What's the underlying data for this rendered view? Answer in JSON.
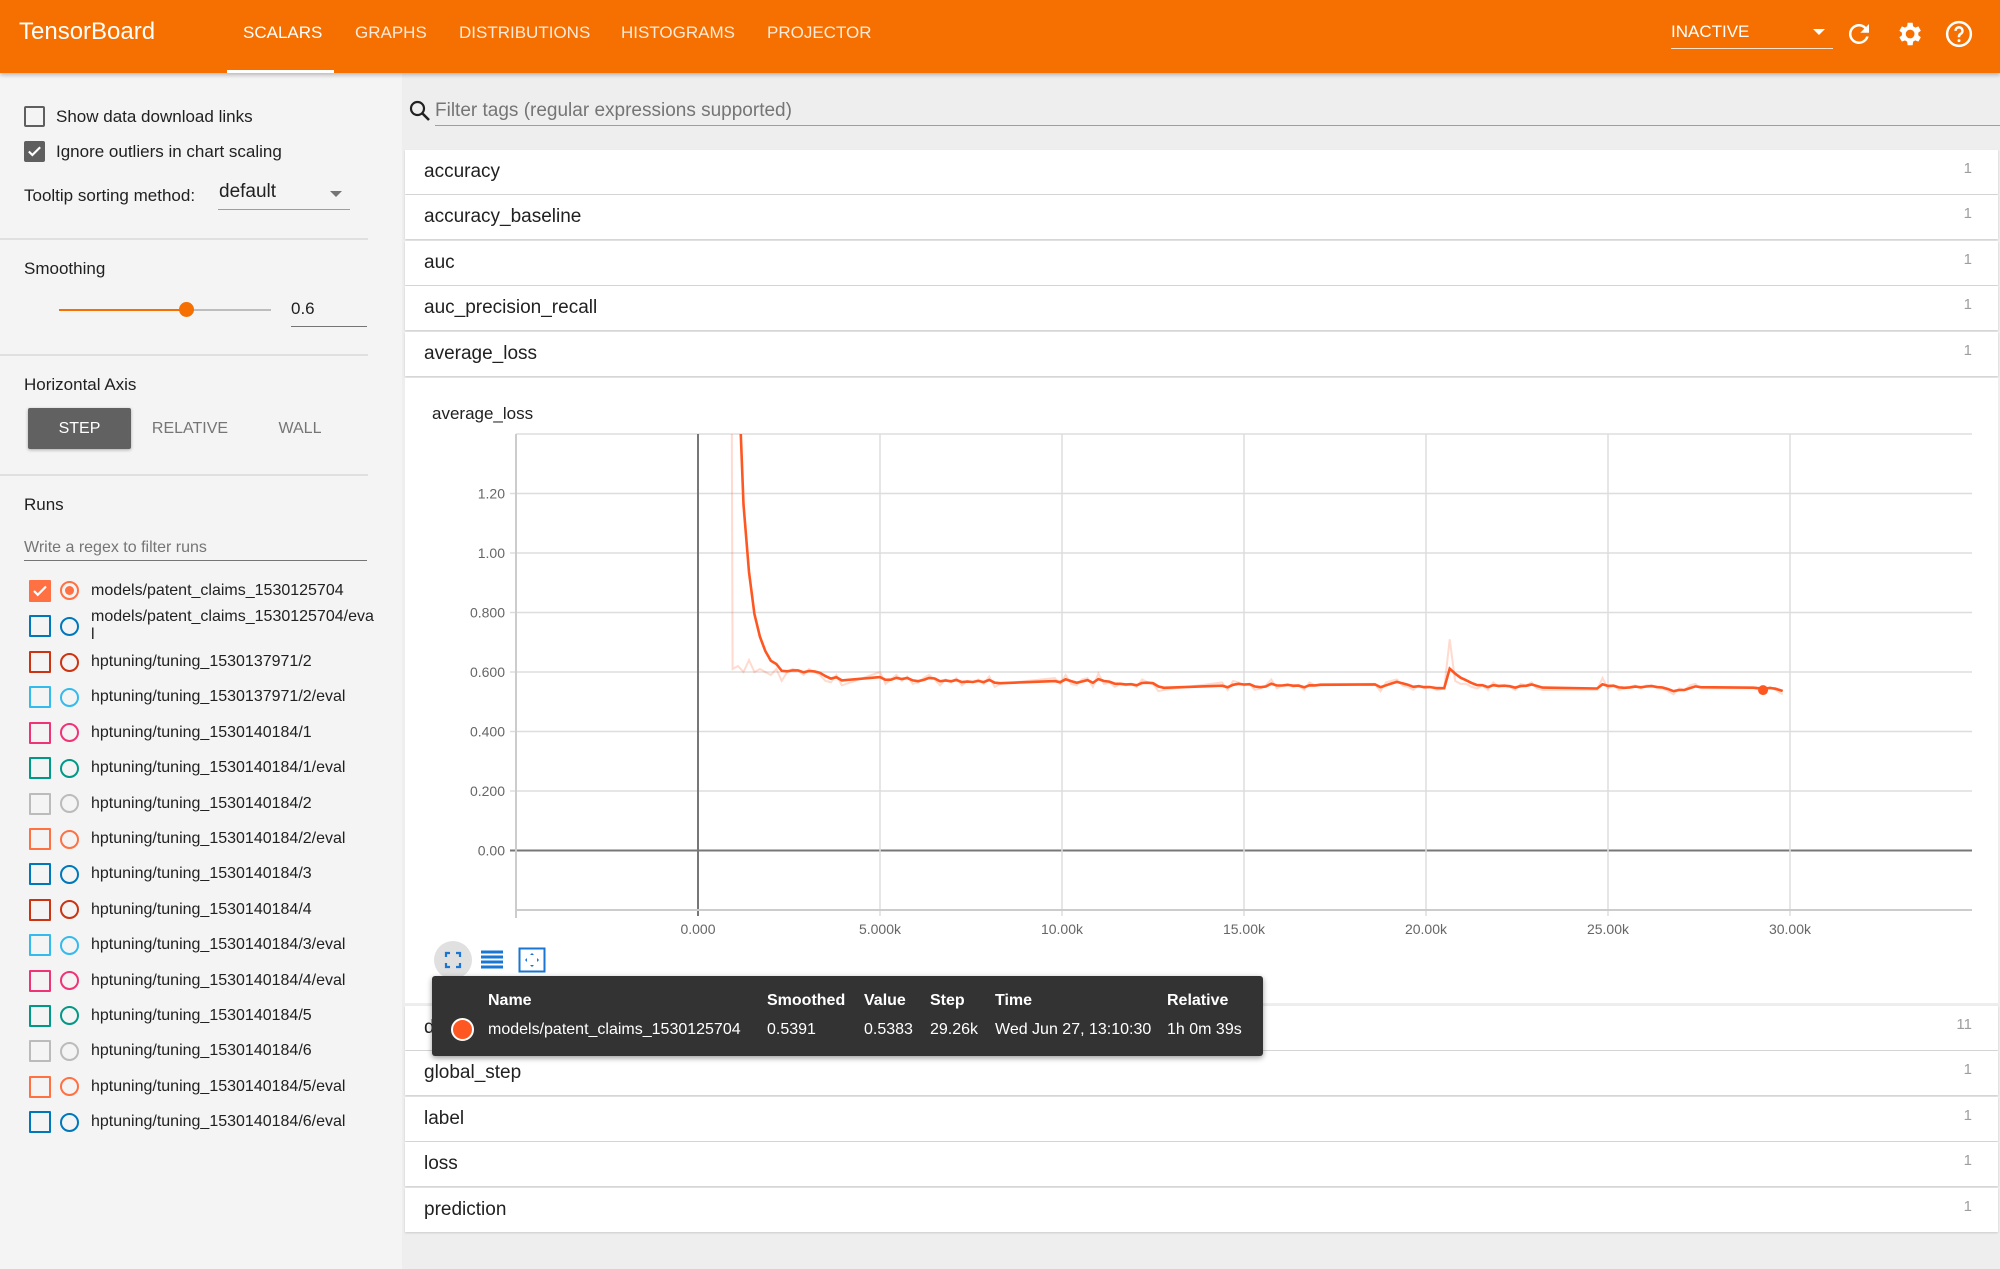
{
  "header": {
    "logo": "TensorBoard",
    "tabs": [
      {
        "label": "SCALARS",
        "active": true
      },
      {
        "label": "GRAPHS",
        "active": false
      },
      {
        "label": "DISTRIBUTIONS",
        "active": false
      },
      {
        "label": "HISTOGRAMS",
        "active": false
      },
      {
        "label": "PROJECTOR",
        "active": false
      }
    ],
    "status_select": "INACTIVE",
    "icons": [
      "refresh-icon",
      "gear-icon",
      "help-icon"
    ],
    "color": "#f57000"
  },
  "sidebar": {
    "show_download_links": {
      "label": "Show data download links",
      "checked": false
    },
    "ignore_outliers": {
      "label": "Ignore outliers in chart scaling",
      "checked": true
    },
    "tooltip_sorting": {
      "label": "Tooltip sorting method:",
      "value": "default"
    },
    "smoothing": {
      "label": "Smoothing",
      "value": "0.6",
      "fraction": 0.6
    },
    "horizontal_axis": {
      "label": "Horizontal Axis",
      "options": [
        "STEP",
        "RELATIVE",
        "WALL"
      ],
      "selected": "STEP"
    },
    "runs": {
      "label": "Runs",
      "filter_placeholder": "Write a regex to filter runs",
      "items": [
        {
          "name": "models/patent_claims_1530125704",
          "color": "#ff7043",
          "checked": true,
          "selected": true
        },
        {
          "name": "models/patent_claims_1530125704/eval",
          "color": "#0077bb",
          "checked": false
        },
        {
          "name": "hptuning/tuning_1530137971/2",
          "color": "#cc3311",
          "checked": false
        },
        {
          "name": "hptuning/tuning_1530137971/2/eval",
          "color": "#33bbee",
          "checked": false
        },
        {
          "name": "hptuning/tuning_1530140184/1",
          "color": "#ee3377",
          "checked": false
        },
        {
          "name": "hptuning/tuning_1530140184/1/eval",
          "color": "#009988",
          "checked": false
        },
        {
          "name": "hptuning/tuning_1530140184/2",
          "color": "#bbbbbb",
          "checked": false
        },
        {
          "name": "hptuning/tuning_1530140184/2/eval",
          "color": "#ff7043",
          "checked": false
        },
        {
          "name": "hptuning/tuning_1530140184/3",
          "color": "#0077bb",
          "checked": false
        },
        {
          "name": "hptuning/tuning_1530140184/4",
          "color": "#cc3311",
          "checked": false
        },
        {
          "name": "hptuning/tuning_1530140184/3/eval",
          "color": "#33bbee",
          "checked": false
        },
        {
          "name": "hptuning/tuning_1530140184/4/eval",
          "color": "#ee3377",
          "checked": false
        },
        {
          "name": "hptuning/tuning_1530140184/5",
          "color": "#009988",
          "checked": false
        },
        {
          "name": "hptuning/tuning_1530140184/6",
          "color": "#bbbbbb",
          "checked": false
        },
        {
          "name": "hptuning/tuning_1530140184/5/eval",
          "color": "#ff7043",
          "checked": false
        },
        {
          "name": "hptuning/tuning_1530140184/6/eval",
          "color": "#0077bb",
          "checked": false
        }
      ]
    }
  },
  "main": {
    "filter_placeholder": "Filter tags (regular expressions supported)",
    "tags_before": [
      {
        "label": "accuracy",
        "count": "1"
      },
      {
        "label": "accuracy_baseline",
        "count": "1"
      },
      {
        "label": "auc",
        "count": "1"
      },
      {
        "label": "auc_precision_recall",
        "count": "1"
      },
      {
        "label": "average_loss",
        "count": "1"
      }
    ],
    "tags_after": [
      {
        "label": "dnn",
        "count": "11"
      },
      {
        "label": "global_step",
        "count": "1"
      },
      {
        "label": "label",
        "count": "1"
      },
      {
        "label": "loss",
        "count": "1"
      },
      {
        "label": "prediction",
        "count": "1"
      }
    ],
    "chart_toolbar": [
      "fullscreen-icon",
      "toggle-log-scale-icon",
      "fit-domain-icon"
    ],
    "tooltip": {
      "headers": [
        "Name",
        "Smoothed",
        "Value",
        "Step",
        "Time",
        "Relative"
      ],
      "row": {
        "name": "models/patent_claims_1530125704",
        "smoothed": "0.5391",
        "value": "0.5383",
        "step": "29.26k",
        "time": "Wed Jun 27, 13:10:30",
        "relative": "1h 0m 39s",
        "color": "#ff5722"
      }
    }
  },
  "chart_data": {
    "type": "line",
    "title": "average_loss",
    "xlabel": "",
    "ylabel": "",
    "xlim": [
      -5000,
      35000
    ],
    "ylim": [
      -0.2,
      1.4
    ],
    "grid": true,
    "x_ticks": [
      0,
      5000,
      10000,
      15000,
      20000,
      25000,
      30000
    ],
    "x_tick_labels": [
      "0.000",
      "5.000k",
      "10.00k",
      "15.00k",
      "20.00k",
      "25.00k",
      "30.00k"
    ],
    "y_ticks": [
      0,
      0.2,
      0.4,
      0.6,
      0.8,
      1.0,
      1.2
    ],
    "y_tick_labels": [
      "0.00",
      "0.200",
      "0.400",
      "0.600",
      "0.800",
      "1.00",
      "1.20"
    ],
    "smoothing": 0.6,
    "color": "#ff5722",
    "highlight": {
      "step": 29260,
      "smoothed": 0.5391,
      "value": 0.5383
    },
    "series": [
      {
        "name": "models/patent_claims_1530125704",
        "points": [
          [
            800,
            6.2
          ],
          [
            950,
            0.61
          ],
          [
            1100,
            0.62
          ],
          [
            1250,
            0.6
          ],
          [
            1400,
            0.64
          ],
          [
            1550,
            0.6
          ],
          [
            1700,
            0.61
          ],
          [
            1850,
            0.6
          ],
          [
            2000,
            0.59
          ],
          [
            2150,
            0.61
          ],
          [
            2300,
            0.57
          ],
          [
            2450,
            0.6
          ],
          [
            2600,
            0.61
          ],
          [
            2750,
            0.605
          ],
          [
            2900,
            0.59
          ],
          [
            3050,
            0.61
          ],
          [
            3200,
            0.6
          ],
          [
            3350,
            0.59
          ],
          [
            3500,
            0.57
          ],
          [
            3650,
            0.565
          ],
          [
            3800,
            0.59
          ],
          [
            3950,
            0.555
          ],
          [
            5000,
            0.6
          ],
          [
            5150,
            0.56
          ],
          [
            5300,
            0.575
          ],
          [
            5450,
            0.59
          ],
          [
            5600,
            0.57
          ],
          [
            5750,
            0.585
          ],
          [
            5900,
            0.56
          ],
          [
            6050,
            0.565
          ],
          [
            6200,
            0.58
          ],
          [
            6350,
            0.59
          ],
          [
            6500,
            0.575
          ],
          [
            6650,
            0.555
          ],
          [
            6800,
            0.575
          ],
          [
            6950,
            0.565
          ],
          [
            7100,
            0.58
          ],
          [
            7250,
            0.555
          ],
          [
            7400,
            0.57
          ],
          [
            7550,
            0.565
          ],
          [
            7700,
            0.575
          ],
          [
            7850,
            0.56
          ],
          [
            8000,
            0.585
          ],
          [
            8150,
            0.55
          ],
          [
            8300,
            0.56
          ],
          [
            9800,
            0.58
          ],
          [
            9950,
            0.56
          ],
          [
            10100,
            0.59
          ],
          [
            10250,
            0.56
          ],
          [
            10400,
            0.555
          ],
          [
            10550,
            0.575
          ],
          [
            10700,
            0.58
          ],
          [
            10850,
            0.55
          ],
          [
            11000,
            0.595
          ],
          [
            11150,
            0.56
          ],
          [
            11300,
            0.565
          ],
          [
            11450,
            0.55
          ],
          [
            11600,
            0.56
          ],
          [
            11750,
            0.555
          ],
          [
            11900,
            0.56
          ],
          [
            12050,
            0.55
          ],
          [
            12200,
            0.575
          ],
          [
            12350,
            0.565
          ],
          [
            12500,
            0.56
          ],
          [
            12650,
            0.535
          ],
          [
            12800,
            0.54
          ],
          [
            14400,
            0.565
          ],
          [
            14550,
            0.54
          ],
          [
            14700,
            0.57
          ],
          [
            14850,
            0.565
          ],
          [
            15000,
            0.555
          ],
          [
            15150,
            0.56
          ],
          [
            15300,
            0.54
          ],
          [
            15450,
            0.545
          ],
          [
            15600,
            0.555
          ],
          [
            15750,
            0.575
          ],
          [
            15900,
            0.545
          ],
          [
            16050,
            0.555
          ],
          [
            16200,
            0.56
          ],
          [
            16350,
            0.55
          ],
          [
            16500,
            0.555
          ],
          [
            16650,
            0.54
          ],
          [
            16800,
            0.565
          ],
          [
            16950,
            0.555
          ],
          [
            17100,
            0.56
          ],
          [
            18600,
            0.56
          ],
          [
            18750,
            0.535
          ],
          [
            18900,
            0.565
          ],
          [
            19050,
            0.57
          ],
          [
            19200,
            0.575
          ],
          [
            19350,
            0.555
          ],
          [
            19500,
            0.55
          ],
          [
            19650,
            0.54
          ],
          [
            19800,
            0.555
          ],
          [
            19950,
            0.545
          ],
          [
            20100,
            0.55
          ],
          [
            20300,
            0.54
          ],
          [
            20500,
            0.545
          ],
          [
            20650,
            0.71
          ],
          [
            20800,
            0.57
          ],
          [
            20950,
            0.56
          ],
          [
            21100,
            0.56
          ],
          [
            21250,
            0.55
          ],
          [
            21400,
            0.545
          ],
          [
            21550,
            0.555
          ],
          [
            21700,
            0.54
          ],
          [
            21850,
            0.565
          ],
          [
            22000,
            0.55
          ],
          [
            22150,
            0.555
          ],
          [
            22300,
            0.55
          ],
          [
            22450,
            0.54
          ],
          [
            22600,
            0.56
          ],
          [
            22750,
            0.555
          ],
          [
            22900,
            0.565
          ],
          [
            23050,
            0.545
          ],
          [
            23200,
            0.54
          ],
          [
            24700,
            0.54
          ],
          [
            24850,
            0.58
          ],
          [
            25000,
            0.545
          ],
          [
            25150,
            0.555
          ],
          [
            25300,
            0.54
          ],
          [
            25450,
            0.545
          ],
          [
            25600,
            0.55
          ],
          [
            25750,
            0.555
          ],
          [
            25900,
            0.545
          ],
          [
            26050,
            0.555
          ],
          [
            26200,
            0.555
          ],
          [
            26350,
            0.545
          ],
          [
            26500,
            0.545
          ],
          [
            26650,
            0.535
          ],
          [
            26800,
            0.525
          ],
          [
            26950,
            0.545
          ],
          [
            27100,
            0.54
          ],
          [
            27250,
            0.555
          ],
          [
            27400,
            0.56
          ],
          [
            27550,
            0.545
          ],
          [
            29000,
            0.545
          ],
          [
            29260,
            0.5383
          ],
          [
            29450,
            0.55
          ],
          [
            29600,
            0.54
          ],
          [
            29800,
            0.525
          ]
        ]
      }
    ]
  }
}
